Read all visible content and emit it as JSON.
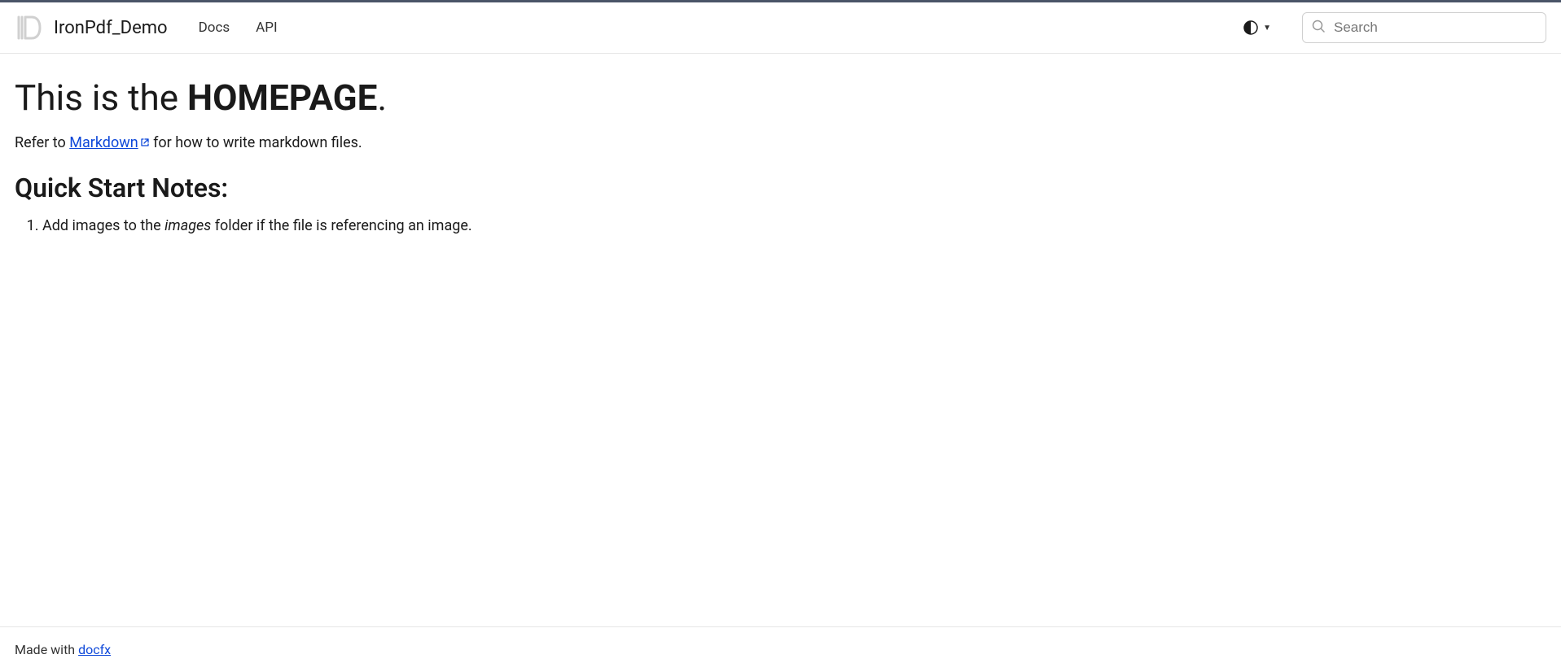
{
  "header": {
    "brand": "IronPdf_Demo",
    "nav": [
      {
        "label": "Docs"
      },
      {
        "label": "API"
      }
    ],
    "search_placeholder": "Search"
  },
  "main": {
    "title_prefix": "This is the ",
    "title_strong": "HOMEPAGE",
    "title_suffix": ".",
    "intro_prefix": "Refer to ",
    "intro_link": "Markdown",
    "intro_suffix": " for how to write markdown files.",
    "subheading": "Quick Start Notes:",
    "notes": {
      "item1_prefix": "Add images to the ",
      "item1_em": "images",
      "item1_suffix": " folder if the file is referencing an image."
    }
  },
  "footer": {
    "prefix": "Made with ",
    "link": "docfx"
  }
}
